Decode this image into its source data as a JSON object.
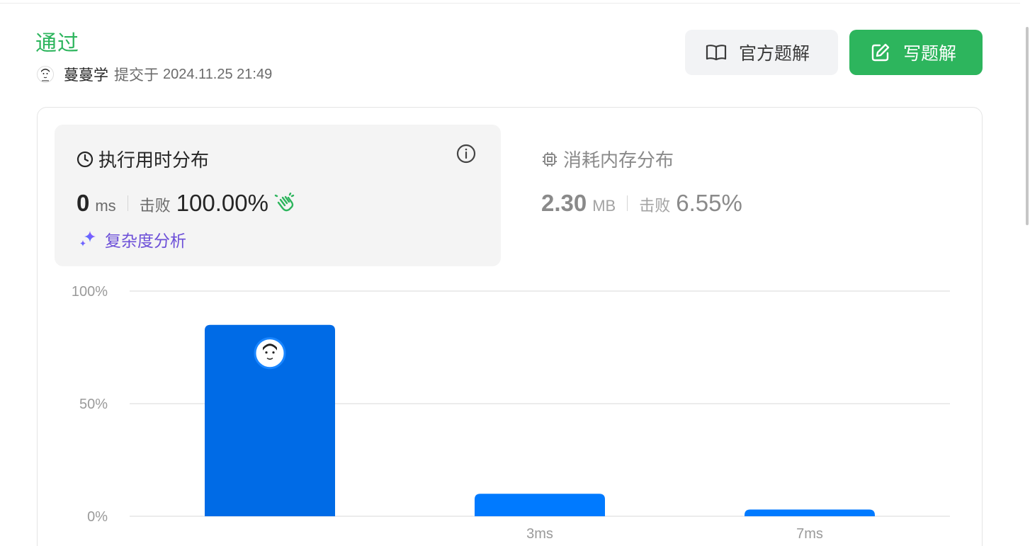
{
  "header": {
    "status": "通过",
    "username": "蔓蔓学",
    "submit_label": "提交于",
    "submit_time": "2024.11.25 21:49",
    "buttons": {
      "official_solution": "官方题解",
      "write_solution": "写题解"
    }
  },
  "runtime": {
    "title": "执行用时分布",
    "value": "0",
    "unit": "ms",
    "beat_label": "击败",
    "beat_value": "100.00%",
    "complexity_link": "复杂度分析"
  },
  "memory": {
    "title": "消耗内存分布",
    "value": "2.30",
    "unit": "MB",
    "beat_label": "击败",
    "beat_value": "6.55%"
  },
  "colors": {
    "accent_green": "#2db55d",
    "bar_selected": "#006be6",
    "bar_default": "#007aff"
  },
  "chart_data": {
    "type": "bar",
    "categories": [
      "",
      "3ms",
      "7ms"
    ],
    "values": [
      85,
      10,
      3
    ],
    "selected_index": 0,
    "yticks": [
      "100%",
      "50%",
      "0%"
    ],
    "ylim": [
      0,
      100
    ],
    "grid": true
  }
}
